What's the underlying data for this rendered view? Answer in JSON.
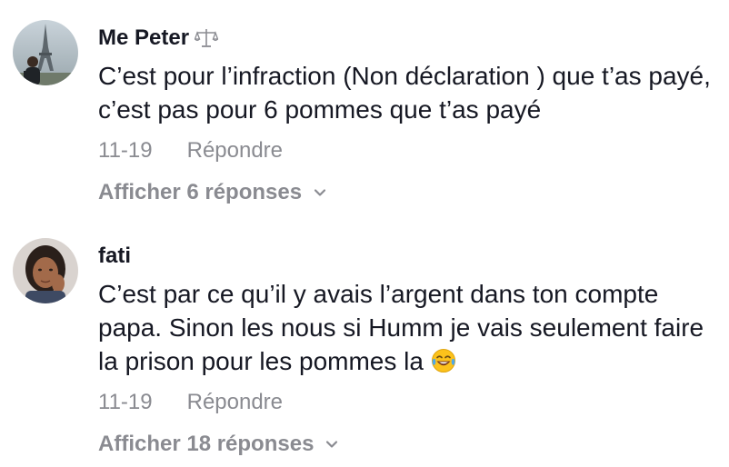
{
  "comments": [
    {
      "username": "Me Peter",
      "badge_icon": "scales-icon",
      "text": "C’est pour l’infraction (Non déclaration ) que t’as payé, c’est pas pour 6 pommes que t’as payé",
      "date": "11-19",
      "reply_label": "Répondre",
      "view_replies_label": "Afficher 6 réponses"
    },
    {
      "username": "fati",
      "text": "C’est par ce qu’il y avais l’argent dans ton compte papa. Sinon les nous si Humm je vais seulement faire la prison pour les pommes la",
      "text_emoji": "laughing-tears-emoji",
      "date": "11-19",
      "reply_label": "Répondre",
      "view_replies_label": "Afficher 18 réponses"
    }
  ],
  "colors": {
    "primary_text": "#161823",
    "secondary_text": "#8a8b91"
  }
}
